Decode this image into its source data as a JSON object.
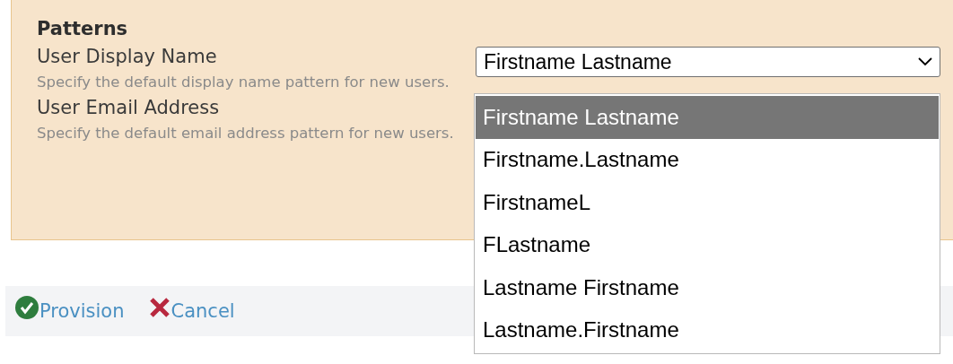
{
  "panel": {
    "title": "Patterns",
    "fields": [
      {
        "label": "User Display Name",
        "description": "Specify the default display name pattern for new users.",
        "value": "Firstname Lastname"
      },
      {
        "label": "User Email Address",
        "description": "Specify the default email address pattern for new users."
      }
    ]
  },
  "dropdown": {
    "options": [
      {
        "label": "Firstname Lastname",
        "selected": true
      },
      {
        "label": "Firstname.Lastname",
        "selected": false
      },
      {
        "label": "FirstnameL",
        "selected": false
      },
      {
        "label": "FLastname",
        "selected": false
      },
      {
        "label": "Lastname Firstname",
        "selected": false
      },
      {
        "label": "Lastname.Firstname",
        "selected": false
      }
    ]
  },
  "actions": [
    {
      "kind": "confirm",
      "label": "Provision"
    },
    {
      "kind": "cancel",
      "label": "Cancel"
    }
  ]
}
